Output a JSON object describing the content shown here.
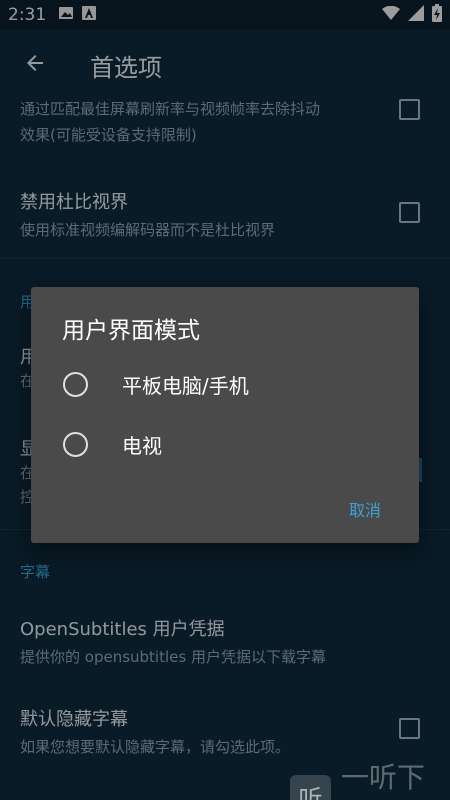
{
  "status_bar": {
    "time": "2:31",
    "icons": [
      "image-icon",
      "a-icon"
    ],
    "right_icons": [
      "wifi-icon",
      "signal-icon",
      "battery-icon"
    ]
  },
  "app_bar": {
    "title": "首选项",
    "back_icon": "arrow-left-icon"
  },
  "prefs": {
    "frame_rate": {
      "subtitle_line1": "通过匹配最佳屏幕刷新率与视频帧率去除抖动",
      "subtitle_line2": "效果(可能受设备支持限制)"
    },
    "dolby": {
      "title": "禁用杜比视界",
      "subtitle": "使用标准视频编解码器而不是杜比视界"
    },
    "ui_section_partial": "用",
    "ui_mode_partial_title": "用",
    "ui_mode_partial_sub": "在",
    "display_partial_title": "显",
    "display_partial_sub1": "在",
    "display_partial_sub2": "控",
    "subtitles_section": "字幕",
    "opensubtitles": {
      "title": "OpenSubtitles 用户凭据",
      "subtitle": "提供你的 opensubtitles 用户凭据以下载字幕"
    },
    "hide_subs": {
      "title": "默认隐藏字幕",
      "subtitle": "如果您想要默认隐藏字幕，请勾选此项。"
    }
  },
  "dialog": {
    "title": "用户界面模式",
    "options": [
      {
        "label": "平板电脑/手机",
        "selected": false
      },
      {
        "label": "电视",
        "selected": false
      }
    ],
    "cancel": "取消"
  },
  "watermark": {
    "badge": "听",
    "text": "一听下载"
  },
  "colors": {
    "background": "#0f2a3c",
    "accent": "#3aa3d9",
    "dialog": "#4a4a4a"
  }
}
